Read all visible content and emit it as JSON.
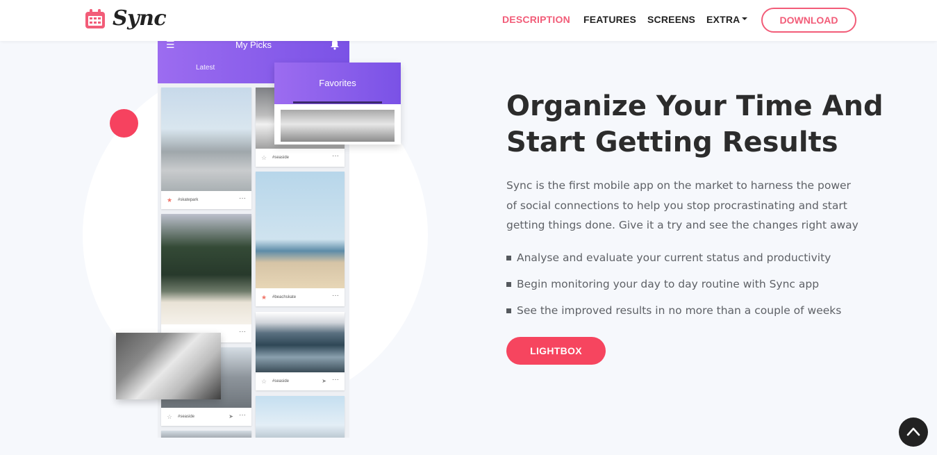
{
  "brand": {
    "name": "Sync"
  },
  "nav": {
    "items": [
      {
        "label": "DESCRIPTION",
        "active": true
      },
      {
        "label": "FEATURES",
        "active": false
      },
      {
        "label": "SCREENS",
        "active": false
      },
      {
        "label": "EXTRA",
        "active": false,
        "dropdown": true
      }
    ],
    "download_label": "DOWNLOAD"
  },
  "phone": {
    "title": "My Picks",
    "tab": "Latest",
    "favorites_tab": "Favorites",
    "cards": [
      {
        "tag": "#skatepark",
        "starred": true
      },
      {
        "tag": "#seaside",
        "starred": false
      },
      {
        "tag": "#beachskate",
        "starred": true
      },
      {
        "tag": "#seaside",
        "starred": false
      },
      {
        "tag": "#seaside",
        "starred": false
      }
    ]
  },
  "hero": {
    "headline_line1": "Organize Your Time And",
    "headline_line2": "Start Getting Results",
    "description": "Sync is the first mobile app on the market to harness the power of social connections to help you stop procrastinating and start getting things done. Give it a try and see the changes right away",
    "bullets": [
      "Analyse and evaluate your current status and productivity",
      "Begin monitoring your day to day routine with Sync app",
      "See the improved results in no more than a couple of weeks"
    ],
    "cta_label": "LIGHTBOX"
  },
  "colors": {
    "accent": "#f25c78",
    "purple": "#8b5ff0",
    "dark": "#222222"
  },
  "icons": [
    "calendar-icon",
    "hamburger-icon",
    "bell-icon",
    "star-icon",
    "send-icon",
    "more-icon",
    "chevron-up-icon"
  ]
}
